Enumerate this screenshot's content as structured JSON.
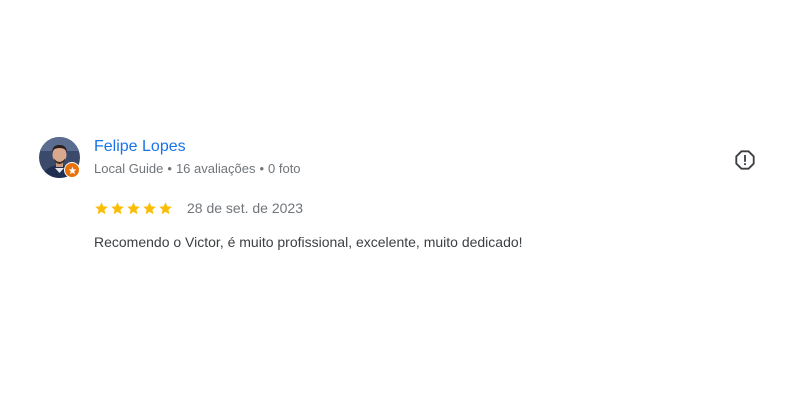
{
  "review": {
    "author": {
      "name": "Felipe Lopes",
      "badge_label": "Local Guide",
      "reviews_count": "16 avaliações",
      "photos_count": "0 foto",
      "separator": "•",
      "avatar_icon": "user-avatar-photo",
      "badge_icon": "local-guide-badge-icon",
      "badge_color": "#e8710a"
    },
    "rating": {
      "value": 5,
      "max": 5,
      "star_color": "#fbbc04"
    },
    "date": "28 de set. de 2023",
    "text": "Recomendo o Victor, é muito profissional, excelente, muito dedicado!",
    "actions": {
      "flag_icon": "report-flag-icon"
    },
    "colors": {
      "name_link": "#1a73e8",
      "meta_text": "#70757a",
      "body_text": "#3c4043"
    }
  }
}
